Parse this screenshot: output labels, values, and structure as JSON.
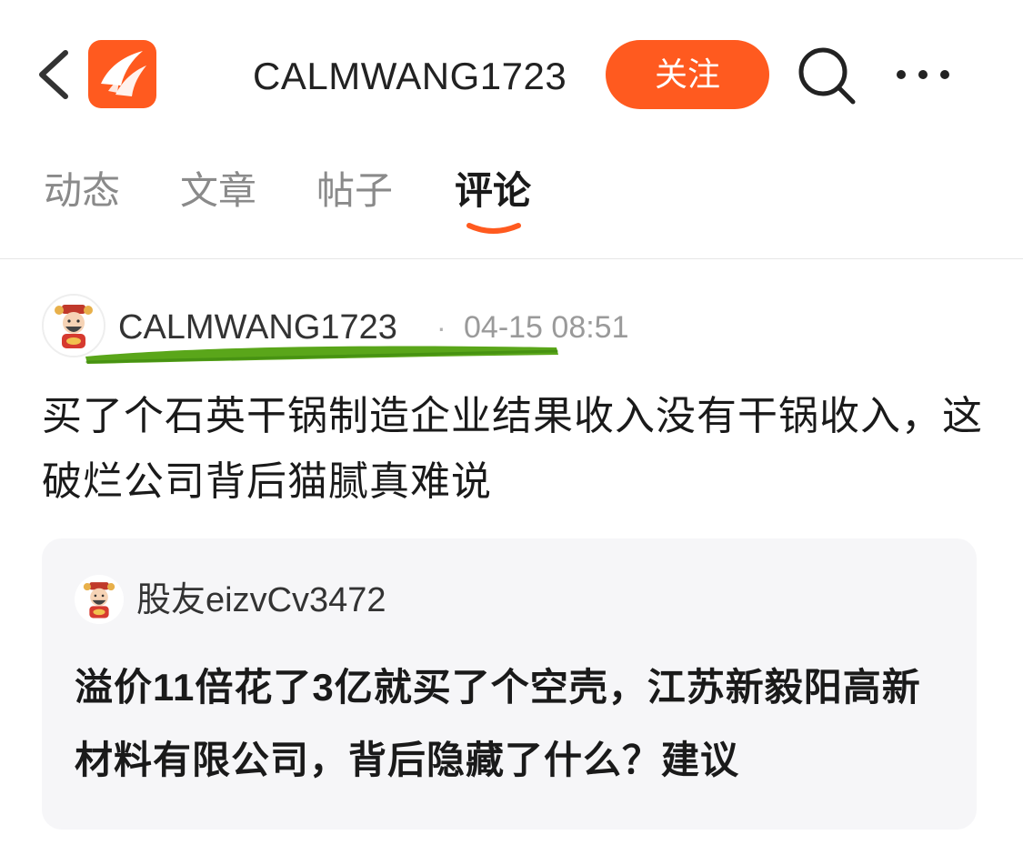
{
  "header": {
    "title": "CALMWANG1723",
    "follow_label": "关注",
    "logo_color": "#ff5a1f",
    "icons": [
      "back-icon",
      "app-logo-icon",
      "search-icon",
      "more-icon"
    ]
  },
  "tabs": [
    {
      "label": "动态",
      "active": false
    },
    {
      "label": "文章",
      "active": false
    },
    {
      "label": "帖子",
      "active": false
    },
    {
      "label": "评论",
      "active": true
    }
  ],
  "post": {
    "author": "CALMWANG1723",
    "separator": "·",
    "time": "04-15 08:51",
    "content": "买了个石英干锅制造企业结果收入没有干锅收入，这破烂公司背后猫腻真难说",
    "highlight_color": "#5aa61a"
  },
  "quote": {
    "author": "股友eizvCv3472",
    "content": "溢价11倍花了3亿就买了个空壳，江苏新毅阳高新材料有限公司，背后隐藏了什么？建议"
  },
  "colors": {
    "accent": "#ff5a1f",
    "card_bg": "#f6f6f8"
  }
}
